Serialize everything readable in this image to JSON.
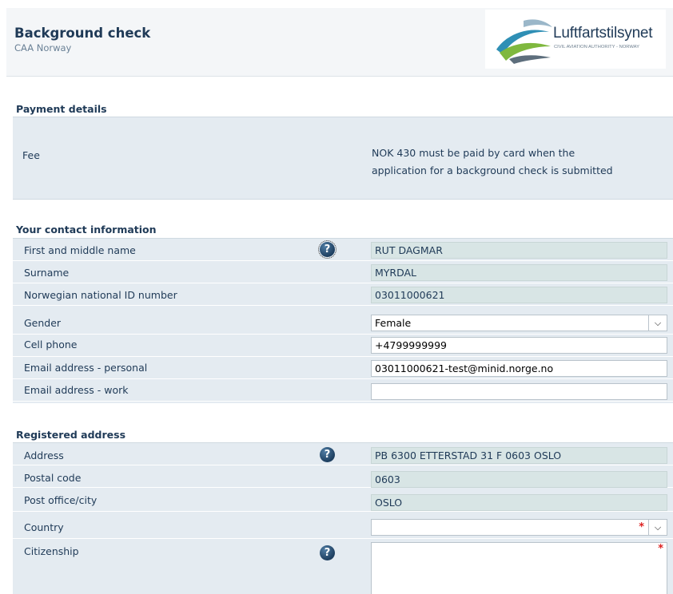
{
  "header": {
    "title": "Background check",
    "subtitle": "CAA Norway",
    "logo_name": "Luftfartstilsynet",
    "logo_tagline": "CIVIL AVIATION AUTHORITY - NORWAY"
  },
  "payment": {
    "section_title": "Payment details",
    "fee_label": "Fee",
    "fee_line1": "NOK 430 must be paid by card when the",
    "fee_line2": "application for a background check is submitted"
  },
  "contact": {
    "section_title": "Your contact information",
    "rows": [
      {
        "label": "First and middle name",
        "value": "RUT DAGMAR"
      },
      {
        "label": "Surname",
        "value": "MYRDAL"
      },
      {
        "label": "Norwegian national ID number",
        "value": "03011000621"
      },
      {
        "label": "Gender",
        "value": "Female"
      },
      {
        "label": "Cell phone",
        "value": "+4799999999"
      },
      {
        "label": "Email address - personal",
        "value": "03011000621-test@minid.norge.no"
      },
      {
        "label": "Email address - work",
        "value": ""
      }
    ]
  },
  "address": {
    "section_title": "Registered address",
    "rows": [
      {
        "label": "Address",
        "value": "PB 6300 ETTERSTAD 31 F 0603 OSLO"
      },
      {
        "label": "Postal code",
        "value": "0603"
      },
      {
        "label": "Post office/city",
        "value": "OSLO"
      },
      {
        "label": "Country",
        "value": ""
      },
      {
        "label": "Citizenship",
        "value": ""
      }
    ]
  },
  "icons": {
    "help": "question-mark-icon",
    "dropdown": "chevron-down-icon",
    "required": "*"
  },
  "colors": {
    "panel": "#e4ebf1",
    "readonly_field": "#d8e5e5",
    "text": "#1f3a57",
    "required": "#dd2222"
  }
}
